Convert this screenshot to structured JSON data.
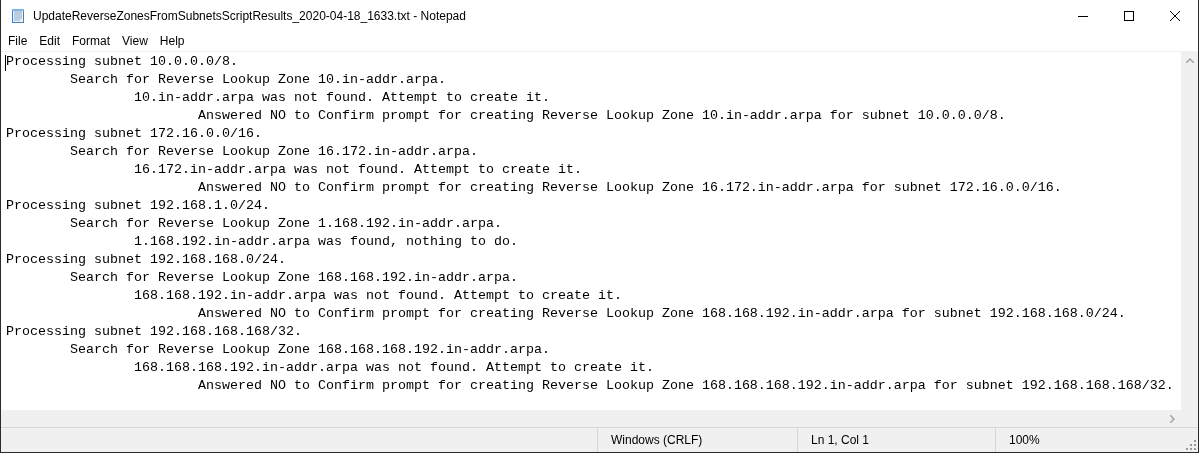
{
  "window": {
    "title": "UpdateReverseZonesFromSubnetsScriptResults_2020-04-18_1633.txt - Notepad"
  },
  "menu": [
    "File",
    "Edit",
    "Format",
    "View",
    "Help"
  ],
  "document": {
    "lines": [
      {
        "text": "Processing subnet 10.0.0.0/8.",
        "children": [
          {
            "text": "Search for Reverse Lookup Zone 10.in-addr.arpa.",
            "children": [
              {
                "text": "10.in-addr.arpa was not found. Attempt to create it.",
                "children": [
                  {
                    "text": "Answered NO to Confirm prompt for creating Reverse Lookup Zone 10.in-addr.arpa for subnet 10.0.0.0/8."
                  }
                ]
              }
            ]
          }
        ]
      },
      {
        "text": "Processing subnet 172.16.0.0/16.",
        "children": [
          {
            "text": "Search for Reverse Lookup Zone 16.172.in-addr.arpa.",
            "children": [
              {
                "text": "16.172.in-addr.arpa was not found. Attempt to create it.",
                "children": [
                  {
                    "text": "Answered NO to Confirm prompt for creating Reverse Lookup Zone 16.172.in-addr.arpa for subnet 172.16.0.0/16."
                  }
                ]
              }
            ]
          }
        ]
      },
      {
        "text": "Processing subnet 192.168.1.0/24.",
        "children": [
          {
            "text": "Search for Reverse Lookup Zone 1.168.192.in-addr.arpa.",
            "children": [
              {
                "text": "1.168.192.in-addr.arpa was found, nothing to do."
              }
            ]
          }
        ]
      },
      {
        "text": "Processing subnet 192.168.168.0/24.",
        "children": [
          {
            "text": "Search for Reverse Lookup Zone 168.168.192.in-addr.arpa.",
            "children": [
              {
                "text": "168.168.192.in-addr.arpa was not found. Attempt to create it.",
                "children": [
                  {
                    "text": "Answered NO to Confirm prompt for creating Reverse Lookup Zone 168.168.192.in-addr.arpa for subnet 192.168.168.0/24."
                  }
                ]
              }
            ]
          }
        ]
      },
      {
        "text": "Processing subnet 192.168.168.168/32.",
        "children": [
          {
            "text": "Search for Reverse Lookup Zone 168.168.168.192.in-addr.arpa.",
            "children": [
              {
                "text": "168.168.168.192.in-addr.arpa was not found. Attempt to create it.",
                "children": [
                  {
                    "text": "Answered NO to Confirm prompt for creating Reverse Lookup Zone 168.168.168.192.in-addr.arpa for subnet 192.168.168.168/32."
                  }
                ]
              }
            ]
          }
        ]
      }
    ]
  },
  "status_bar": {
    "line_ending": "Windows (CRLF)",
    "position": "Ln 1, Col 1",
    "zoom": "100%"
  }
}
